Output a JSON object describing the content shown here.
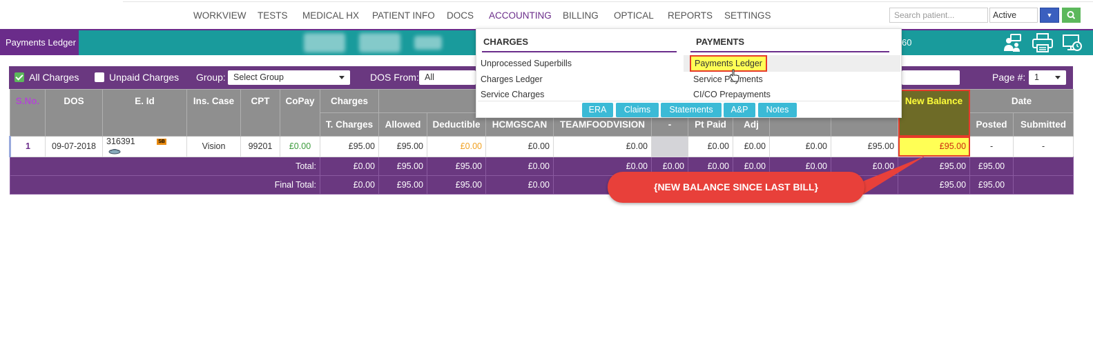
{
  "nav": {
    "items": [
      "WORKVIEW",
      "TESTS",
      "MEDICAL HX",
      "PATIENT INFO",
      "DOCS",
      "ACCOUNTING",
      "BILLING",
      "OPTICAL",
      "REPORTS",
      "SETTINGS"
    ],
    "active": "ACCOUNTING",
    "search_placeholder": "Search patient...",
    "status_value": "Active"
  },
  "header": {
    "page_tag": "Payments Ledger",
    "partial_number": "60"
  },
  "filters": {
    "all_charges_label": "All Charges",
    "all_charges_checked": true,
    "unpaid_charges_label": "Unpaid Charges",
    "unpaid_charges_checked": false,
    "group_label": "Group:",
    "group_value": "Select Group",
    "dos_from_label": "DOS From:",
    "dos_from_value": "All",
    "page_label": "Page #:",
    "page_value": "1"
  },
  "table": {
    "top_headers": {
      "sno": "S.No.",
      "dos": "DOS",
      "eid": "E. Id",
      "ins_case": "Ins. Case",
      "cpt": "CPT",
      "copay": "CoPay",
      "charges": "Charges",
      "new_balance": "New Balance",
      "date": "Date"
    },
    "sub_headers": {
      "t_charges": "T. Charges",
      "allowed": "Allowed",
      "deductible": "Deductible",
      "hcmgscan": "HCMGSCAN",
      "teamfoodvision": "TEAMFOODVISION",
      "dash": "-",
      "pt_paid": "Pt Paid",
      "adj": "Adj",
      "posted": "Posted",
      "submitted": "Submitted"
    },
    "row": {
      "sno": "1",
      "dos": "09-07-2018",
      "eid": "316391",
      "eid_badge": "SB",
      "ins_case": "Vision",
      "cpt": "99201",
      "copay": "£0.00",
      "t_charges": "£95.00",
      "allowed": "£95.00",
      "deductible": "£0.00",
      "hcmgscan": "£0.00",
      "teamfoodvision": "£0.00",
      "dash": "",
      "pt_paid": "£0.00",
      "adj": "£0.00",
      "col_x": "£0.00",
      "col_y": "£95.00",
      "new_balance": "£95.00",
      "posted": "-",
      "submitted": "-"
    },
    "total": {
      "label": "Total:",
      "copay": "£0.00",
      "t_charges": "£95.00",
      "allowed": "£95.00",
      "deductible": "£0.00",
      "hcmgscan": "£0.00",
      "teamfoodvision": "£0.00",
      "dash": "£0.00",
      "pt_paid": "£0.00",
      "adj": "£0.00",
      "col_x": "£0.00",
      "col_y": "£95.00",
      "new_balance": "£95.00"
    },
    "final_total": {
      "label": "Final Total:",
      "copay": "£0.00",
      "t_charges": "£95.00",
      "allowed": "£95.00",
      "deductible": "£0.00",
      "hcmgscan": "£0.00",
      "col_y": "£95.00",
      "new_balance": "£95.00"
    }
  },
  "menu": {
    "charges_heading": "CHARGES",
    "payments_heading": "PAYMENTS",
    "charges_items": [
      "Unprocessed Superbills",
      "Charges Ledger",
      "Service Charges"
    ],
    "payments_items": [
      "Payments Ledger",
      "Service Payments",
      "CI/CO Prepayments"
    ],
    "buttons": [
      "ERA",
      "Claims",
      "Statements",
      "A&P",
      "Notes"
    ]
  },
  "callout": {
    "text": "{NEW BALANCE SINCE LAST BILL}"
  },
  "colors": {
    "purple": "#6a3880",
    "teal": "#199b9c",
    "highlight_yellow": "#ffff55",
    "callout_red": "#e8403a",
    "menu_button": "#3bbad6"
  }
}
